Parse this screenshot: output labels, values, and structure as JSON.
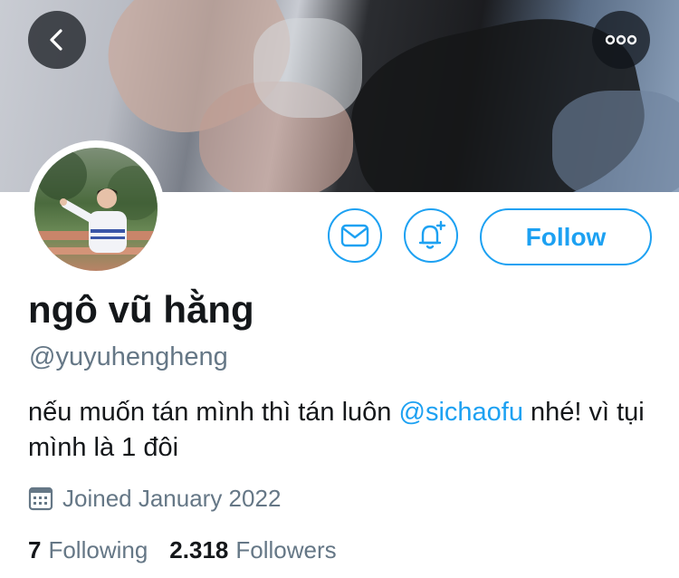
{
  "header": {
    "back_icon": "chevron-left-icon",
    "more_icon": "more-horizontal-icon"
  },
  "actions": {
    "message_icon": "mail-icon",
    "notify_icon": "bell-plus-icon",
    "follow_label": "Follow",
    "accent_color": "#1da1f2"
  },
  "profile": {
    "display_name": "ngô vũ hằng",
    "handle": "@yuyuhengheng",
    "bio": {
      "before": "nếu muốn tán mình thì tán luôn ",
      "mention": "@sichaofu",
      "after": " nhé! vì tụi mình là 1 đôi"
    },
    "joined": "Joined January 2022",
    "joined_icon": "calendar-icon"
  },
  "stats": {
    "following_count": "7",
    "following_label": "Following",
    "followers_count": "2.318",
    "followers_label": "Followers"
  }
}
